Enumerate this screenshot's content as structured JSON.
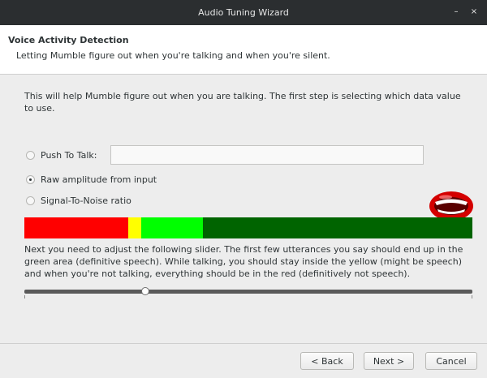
{
  "window": {
    "title": "Audio Tuning Wizard",
    "minimize": "–",
    "close": "×"
  },
  "header": {
    "title": "Voice Activity Detection",
    "subtitle": "Letting Mumble figure out when you're talking and when you're silent."
  },
  "intro": "This will help Mumble figure out when you are talking. The first step is selecting which data value to use.",
  "options": [
    {
      "label": "Push To Talk:",
      "checked": false
    },
    {
      "label": "Raw amplitude from input",
      "checked": true
    },
    {
      "label": "Signal-To-Noise ratio",
      "checked": false
    }
  ],
  "ptt_field": {
    "value": ""
  },
  "icons": {
    "speaking": "talking-mouth-icon"
  },
  "vad_bar": {
    "segments": [
      {
        "name": "red",
        "color": "#ff0000"
      },
      {
        "name": "yellow",
        "color": "#ffff00"
      },
      {
        "name": "light-green",
        "color": "#00ff00"
      },
      {
        "name": "dark-green",
        "color": "#006400"
      }
    ]
  },
  "instructions": "Next you need to adjust the following slider. The first few utterances you say should end up in the green area (definitive speech). While talking, you should stay inside the yellow (might be speech) and when you're not talking, everything should be in the red (definitively not speech).",
  "slider": {
    "value_fraction": 0.27
  },
  "buttons": {
    "back": "< Back",
    "next": "Next >",
    "cancel": "Cancel"
  }
}
